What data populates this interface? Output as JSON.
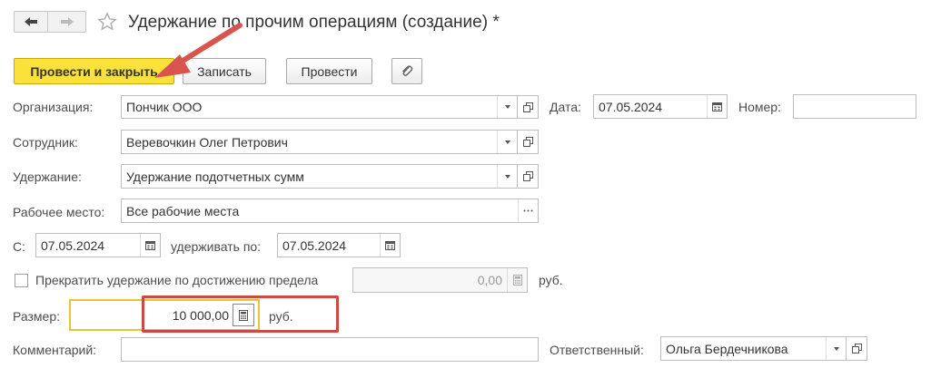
{
  "window": {
    "title": "Удержание по прочим операциям (создание) *"
  },
  "toolbar": {
    "post_close_label": "Провести и закрыть",
    "save_label": "Записать",
    "post_label": "Провести"
  },
  "form": {
    "organization": {
      "label": "Организация:",
      "value": "Пончик ООО"
    },
    "date": {
      "label": "Дата:",
      "value": "07.05.2024"
    },
    "number": {
      "label": "Номер:",
      "value": ""
    },
    "employee": {
      "label": "Сотрудник:",
      "value": "Веревочкин Олег Петрович"
    },
    "deduction": {
      "label": "Удержание:",
      "value": "Удержание подотчетных сумм"
    },
    "workplace": {
      "label": "Рабочее место:",
      "value": "Все рабочие места"
    },
    "from": {
      "label": "С:",
      "value": "07.05.2024"
    },
    "until": {
      "label": "удерживать по:",
      "value": "07.05.2024"
    },
    "stop_limit": {
      "label": "Прекратить удержание по достижению предела",
      "value": "0,00",
      "currency": "руб."
    },
    "amount": {
      "label": "Размер:",
      "value": "10 000,00",
      "currency": "руб."
    },
    "comment": {
      "label": "Комментарий:",
      "value": ""
    },
    "responsible": {
      "label": "Ответственный:",
      "value": "Ольга Бердечникова"
    }
  },
  "colors": {
    "primary_button": "#fbe13a",
    "highlight_box": "#c94b43",
    "focus_border": "#e8c33a"
  }
}
